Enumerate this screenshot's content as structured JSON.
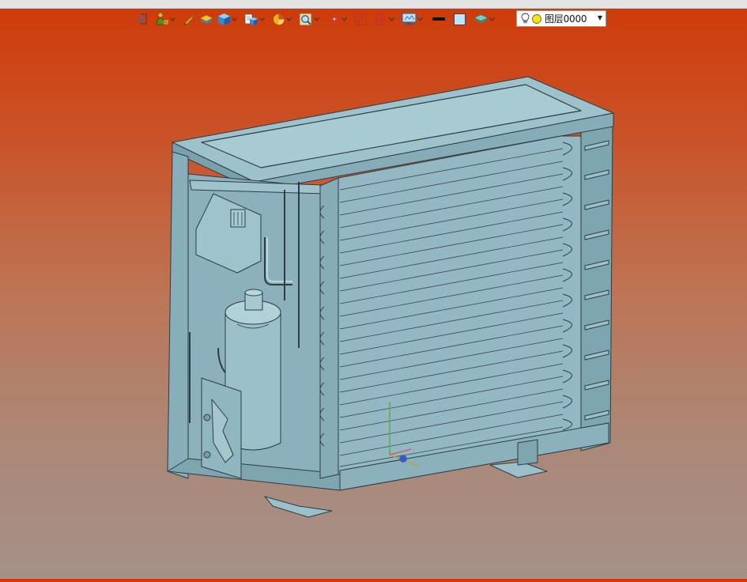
{
  "toolbar": {
    "tools": [
      {
        "icon": "exit-sketch-icon"
      },
      {
        "icon": "person-view-icon",
        "dropdown": true
      },
      {
        "icon": "pencil-icon"
      },
      {
        "icon": "solid-layer-icon"
      },
      {
        "icon": "cube-icon",
        "dropdown": true
      },
      {
        "icon": "document-cube-icon",
        "dropdown": true
      },
      {
        "icon": "section-pie-icon",
        "dropdown": true
      },
      {
        "icon": "zoom-fit-icon",
        "dropdown": true
      },
      {
        "icon": "axis-triad-icon",
        "dropdown": true
      },
      {
        "icon": "measure-icon"
      },
      {
        "icon": "grid-view-icon",
        "dropdown": true
      },
      {
        "icon": "monitor-display-icon",
        "dropdown": true
      },
      {
        "icon": "line-color-icon"
      },
      {
        "icon": "fill-color-icon"
      },
      {
        "icon": "layer-stack-icon",
        "dropdown": true
      }
    ],
    "layer": {
      "name": "图层0000"
    }
  },
  "colors": {
    "accent": "#6c9baa",
    "model": "#8fb4bf",
    "edge": "#2b3d44",
    "background_top": "#cf3a08",
    "background_bottom": "#a59189"
  }
}
